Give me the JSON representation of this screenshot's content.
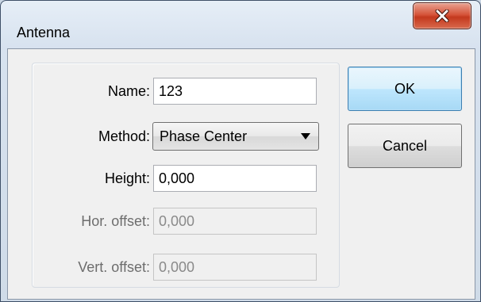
{
  "window": {
    "title": "Antenna",
    "close_icon": "close-icon"
  },
  "form": {
    "name": {
      "label": "Name:",
      "value": "123"
    },
    "method": {
      "label": "Method:",
      "value": "Phase Center",
      "icon": "dropdown-arrow-icon"
    },
    "height": {
      "label": "Height:",
      "value": "0,000"
    },
    "hor_offset": {
      "label": "Hor. offset:",
      "value": "0,000",
      "enabled": false
    },
    "vert_offset": {
      "label": "Vert. offset:",
      "value": "0,000",
      "enabled": false
    }
  },
  "buttons": {
    "ok": "OK",
    "cancel": "Cancel"
  },
  "colors": {
    "close_button": "#c3391e",
    "default_button_border": "#3c7fb1"
  }
}
